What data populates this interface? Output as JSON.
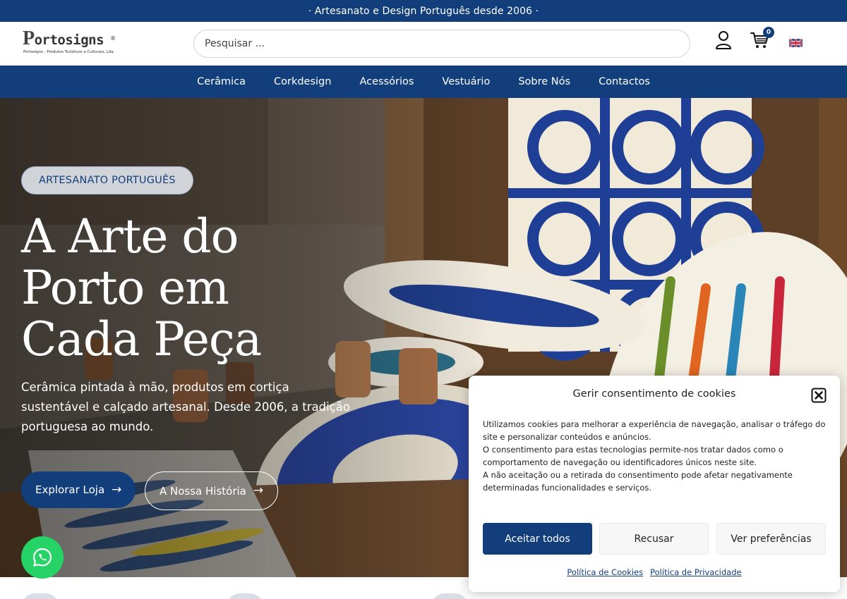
{
  "announcement": "· Artesanato e Design Português desde 2006 ·",
  "header": {
    "logo_text": "ortosigns",
    "logo_p": "P",
    "logo_reg": "®",
    "logo_subtitle": "Portosigns - Produtos Turísticos e Culturais, Lda.",
    "search_placeholder": "Pesquisar ...",
    "cart_count": "0",
    "icons": [
      "user-icon",
      "cart-icon",
      "uk-flag-icon"
    ]
  },
  "nav": {
    "items": [
      "Cerâmica",
      "Corkdesign",
      "Acessórios",
      "Vestuário",
      "Sobre Nós",
      "Contactos"
    ]
  },
  "hero": {
    "badge": "ARTESANATO PORTUGUÊS",
    "title_line1": "A Arte do",
    "title_line2": "Porto em",
    "title_line3": "Cada Peça",
    "description": "Cerâmica pintada à mão, produtos em cortiça sustentável e calçado artesanal. Desde 2006, a tradição portuguesa ao mundo.",
    "primary_button": "Explorar Loja",
    "secondary_button": "A Nossa História",
    "arrow": "→"
  },
  "cookie": {
    "title": "Gerir consentimento de cookies",
    "paragraph1": "Utilizamos cookies para melhorar a experiência de navegação, analisar o tráfego do site e personalizar conteúdos e anúncios.",
    "paragraph2": "O consentimento para estas tecnologias permite-nos tratar dados como o comportamento de navegação ou identificadores únicos neste site.",
    "paragraph3": "A não aceitação ou a retirada do consentimento pode afetar negativamente determinadas funcionalidades e serviços.",
    "accept": "Aceitar todos",
    "deny": "Recusar",
    "preferences": "Ver preferências",
    "cookie_policy": "Política de Cookies",
    "privacy_policy": "Política de Privacidade"
  },
  "colors": {
    "brand_blue": "#123f7c",
    "whatsapp_green": "#25d366"
  }
}
